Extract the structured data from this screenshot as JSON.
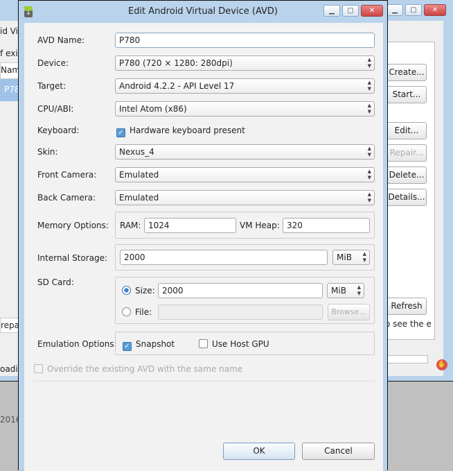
{
  "background_window": {
    "title_fragment": "id Vir",
    "text1": "f exis",
    "col_header": "Nam",
    "row": "P78",
    "status_fragment": "repa",
    "loading_fragment": "oadin",
    "date_fragment": "2016",
    "hint_fragment": "o see the e",
    "buttons": {
      "create": "Create...",
      "start": "Start...",
      "edit": "Edit...",
      "repair": "Repair...",
      "delete": "Delete...",
      "details": "Details...",
      "refresh": "Refresh"
    }
  },
  "dialog": {
    "title": "Edit Android Virtual Device (AVD)",
    "avd_name": {
      "label": "AVD Name:",
      "value": "P780"
    },
    "device": {
      "label": "Device:",
      "value": "P780 (720 × 1280: 280dpi)"
    },
    "target": {
      "label": "Target:",
      "value": "Android 4.2.2 - API Level 17"
    },
    "cpu": {
      "label": "CPU/ABI:",
      "value": "Intel Atom (x86)"
    },
    "keyboard": {
      "label": "Keyboard:",
      "checkbox": "Hardware keyboard present",
      "checked": true
    },
    "skin": {
      "label": "Skin:",
      "value": "Nexus_4"
    },
    "front_camera": {
      "label": "Front Camera:",
      "value": "Emulated"
    },
    "back_camera": {
      "label": "Back Camera:",
      "value": "Emulated"
    },
    "memory": {
      "label": "Memory Options:",
      "ram_label": "RAM:",
      "ram": "1024",
      "heap_label": "VM Heap:",
      "heap": "320"
    },
    "storage": {
      "label": "Internal Storage:",
      "value": "2000",
      "unit": "MiB"
    },
    "sdcard": {
      "label": "SD Card:",
      "size_label": "Size:",
      "size": "2000",
      "unit": "MiB",
      "file_label": "File:",
      "file": "",
      "browse": "Browse..."
    },
    "emulation": {
      "label": "Emulation Options:",
      "snapshot": "Snapshot",
      "snapshot_checked": true,
      "gpu": "Use Host GPU",
      "gpu_checked": false
    },
    "override": "Override the existing AVD with the same name",
    "ok": "OK",
    "cancel": "Cancel"
  }
}
